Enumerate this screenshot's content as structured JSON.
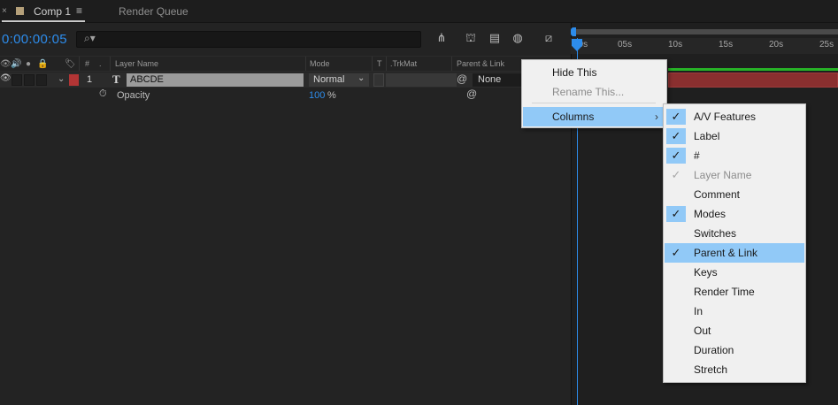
{
  "colors": {
    "accent": "#2d8ceb",
    "label_red": "#b23535",
    "menu_highlight": "#91c9f7",
    "green_bar": "#27b327"
  },
  "tabs": [
    {
      "close": "×",
      "label": "Comp 1",
      "menu": "≡"
    },
    {
      "label": "Render Queue"
    }
  ],
  "toolbar": {
    "timecode": "0:00:00:05",
    "search_icon": "⌕▾"
  },
  "columns": {
    "hash": "#",
    "layer_name": "Layer Name",
    "mode": "Mode",
    "t": "T",
    "trkmat": ".TrkMat",
    "parent_link": "Parent & Link"
  },
  "layer": {
    "number": "1",
    "type_icon": "T",
    "name": "ABCDE",
    "mode": "Normal",
    "parent": "None"
  },
  "property": {
    "name": "Opacity",
    "value": "100",
    "unit": "%"
  },
  "ruler": {
    "ticks": [
      "00s",
      "05s",
      "10s",
      "15s",
      "20s",
      "25s"
    ]
  },
  "context_menu": {
    "items": [
      {
        "label": "Hide This",
        "enabled": true
      },
      {
        "label": "Rename This...",
        "enabled": false
      },
      {
        "label": "Columns",
        "submenu": true,
        "highlighted": true
      }
    ]
  },
  "columns_menu": {
    "items": [
      {
        "label": "A/V Features",
        "checked": true
      },
      {
        "label": "Label",
        "checked": true
      },
      {
        "label": "#",
        "checked": true
      },
      {
        "label": "Layer Name",
        "checked": true,
        "enabled": false
      },
      {
        "label": "Comment",
        "checked": false
      },
      {
        "label": "Modes",
        "checked": true
      },
      {
        "label": "Switches",
        "checked": false
      },
      {
        "label": "Parent & Link",
        "checked": true,
        "highlighted": true
      },
      {
        "label": "Keys",
        "checked": false
      },
      {
        "label": "Render Time",
        "checked": false
      },
      {
        "label": "In",
        "checked": false
      },
      {
        "label": "Out",
        "checked": false
      },
      {
        "label": "Duration",
        "checked": false
      },
      {
        "label": "Stretch",
        "checked": false
      }
    ]
  }
}
